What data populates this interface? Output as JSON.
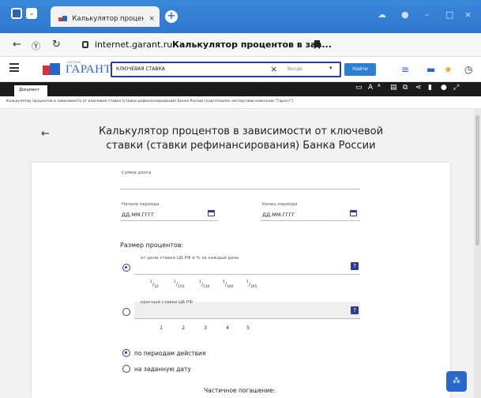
{
  "browser": {
    "tab_title": "Калькулятор процентс",
    "tab_close": "×",
    "new_tab": "+",
    "url": "internet.garant.ru",
    "page_title": "Калькулятор процентов в зав..."
  },
  "garant": {
    "logo": "ГАРАНТ",
    "logo_small": "система",
    "search_value": "КЛЮЧЕВАЯ СТАВКА",
    "search_clear": "×",
    "search_scope": "Везде",
    "find_label": "Найти"
  },
  "doc": {
    "tab": "Документ",
    "breadcrumb": "Калькулятор процентов в зависимости от ключевой ставки (ставки рефинансирования) Банка России (подготовлен экспертами компании \"Гарант\")"
  },
  "calc": {
    "back": "←",
    "title_line1": "Калькулятор процентов в зависимости от ключевой",
    "title_line2": "ставки (ставки рефинансирования) Банка России",
    "debt_label": "Сумма долга",
    "start_label": "Начало периода",
    "start_placeholder": "ДД.ММ.ГГГГ",
    "end_label": "Конец периода",
    "end_placeholder": "ДД.ММ.ГГГГ",
    "rate_section": "Размер процентов:",
    "share_label": "от доли ставки ЦБ РФ в % за каждый день",
    "share_fracs": [
      {
        "num": "1",
        "den": "10"
      },
      {
        "num": "1",
        "den": "150"
      },
      {
        "num": "1",
        "den": "130"
      },
      {
        "num": "1",
        "den": "300"
      },
      {
        "num": "1",
        "den": "365"
      }
    ],
    "multiple_label": "кратный ставки ЦБ РФ",
    "multiples": [
      "1",
      "2",
      "3",
      "4",
      "5"
    ],
    "help": "?",
    "calc_mode_periods": "по периодам действия",
    "calc_mode_date": "на заданную дату",
    "partial": "Частичное погашение:"
  },
  "colors": {
    "accent": "#2e3b8f",
    "brand_blue": "#2868c8",
    "brand_red": "#d5323b"
  }
}
